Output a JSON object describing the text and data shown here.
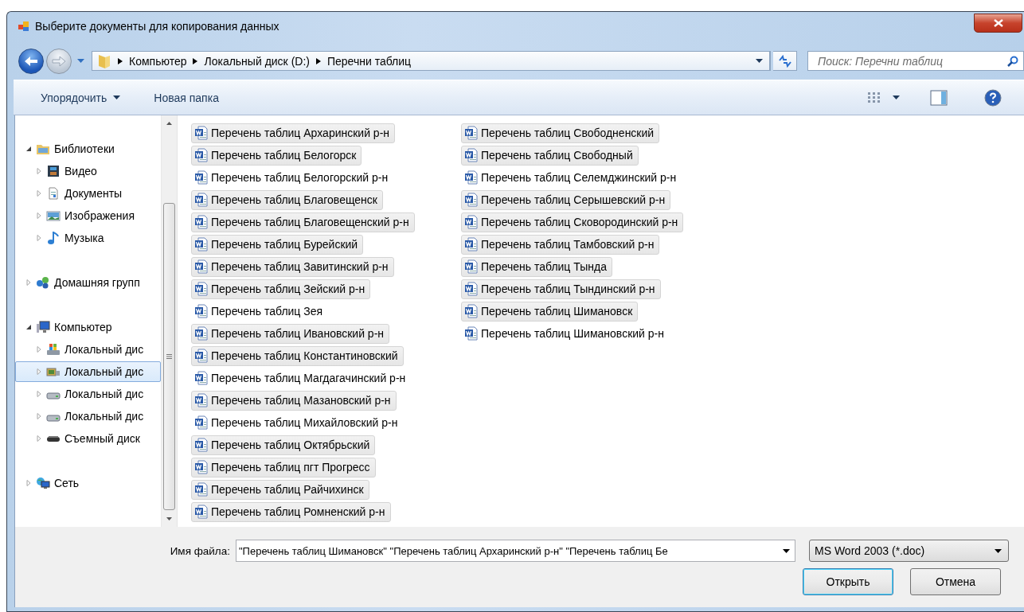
{
  "window": {
    "title": "Выберите документы для копирования данных"
  },
  "navigation": {
    "breadcrumb": [
      "Компьютер",
      "Локальный диск (D:)",
      "Перечни таблиц"
    ],
    "search": {
      "placeholder": "Поиск: Перечни таблиц"
    }
  },
  "toolbar": {
    "items": [
      {
        "label": "Упорядочить",
        "dropdown": true
      },
      {
        "label": "Новая папка",
        "dropdown": false
      }
    ]
  },
  "tree": [
    {
      "label": "Библиотеки",
      "kind": "library",
      "expanded": true,
      "selected": false,
      "children": [
        {
          "label": "Видео",
          "kind": "video",
          "expanded": false,
          "selected": false
        },
        {
          "label": "Документы",
          "kind": "documents",
          "expanded": false,
          "selected": false
        },
        {
          "label": "Изображения",
          "kind": "pictures",
          "expanded": false,
          "selected": false
        },
        {
          "label": "Музыка",
          "kind": "music",
          "expanded": false,
          "selected": false
        }
      ]
    },
    {
      "label": "Домашняя групп",
      "kind": "homegroup",
      "expanded": false,
      "selected": false
    },
    {
      "label": "Компьютер",
      "kind": "computer",
      "expanded": true,
      "selected": false,
      "children": [
        {
          "label": "Локальный дис",
          "kind": "system-drive",
          "expanded": false,
          "selected": false
        },
        {
          "label": "Локальный дис",
          "kind": "media-drive",
          "expanded": false,
          "selected": true
        },
        {
          "label": "Локальный дис",
          "kind": "drive",
          "expanded": false,
          "selected": false
        },
        {
          "label": "Локальный дис",
          "kind": "drive",
          "expanded": false,
          "selected": false
        },
        {
          "label": "Съемный диск",
          "kind": "removable",
          "expanded": false,
          "selected": false
        }
      ]
    },
    {
      "label": "Сеть",
      "kind": "network",
      "expanded": false,
      "selected": false
    }
  ],
  "files": [
    {
      "name": "Перечень таблиц Архаринский р-н",
      "selected": true
    },
    {
      "name": "Перечень таблиц Белогорск",
      "selected": true
    },
    {
      "name": "Перечень таблиц Белогорский р-н",
      "selected": false
    },
    {
      "name": "Перечень таблиц Благовещенск",
      "selected": true
    },
    {
      "name": "Перечень таблиц Благовещенский р-н",
      "selected": true
    },
    {
      "name": "Перечень таблиц Бурейский",
      "selected": true
    },
    {
      "name": "Перечень таблиц Завитинский р-н",
      "selected": true
    },
    {
      "name": "Перечень таблиц Зейский р-н",
      "selected": true
    },
    {
      "name": "Перечень таблиц Зея",
      "selected": false
    },
    {
      "name": "Перечень таблиц Ивановский р-н",
      "selected": true
    },
    {
      "name": "Перечень таблиц Константиновский",
      "selected": true
    },
    {
      "name": "Перечень таблиц Магдагачинский р-н",
      "selected": false
    },
    {
      "name": "Перечень таблиц Мазановский р-н",
      "selected": true
    },
    {
      "name": "Перечень таблиц Михайловский р-н",
      "selected": false
    },
    {
      "name": "Перечень таблиц Октябрьский",
      "selected": true
    },
    {
      "name": "Перечень таблиц пгт Прогресс",
      "selected": true
    },
    {
      "name": "Перечень таблиц Райчихинск",
      "selected": true
    },
    {
      "name": "Перечень таблиц Ромненский р-н",
      "selected": true
    },
    {
      "name": "Перечень таблиц Свободненский",
      "selected": true
    },
    {
      "name": "Перечень таблиц Свободный",
      "selected": true
    },
    {
      "name": "Перечень таблиц Селемджинский р-н",
      "selected": false
    },
    {
      "name": "Перечень таблиц Серышевский р-н",
      "selected": true
    },
    {
      "name": "Перечень таблиц Сковородинский р-н",
      "selected": true
    },
    {
      "name": "Перечень таблиц Тамбовский р-н",
      "selected": true
    },
    {
      "name": "Перечень таблиц Тында",
      "selected": true
    },
    {
      "name": "Перечень таблиц Тындинский р-н",
      "selected": true
    },
    {
      "name": "Перечень таблиц Шимановск",
      "selected": true
    },
    {
      "name": "Перечень таблиц Шимановский р-н",
      "selected": false
    }
  ],
  "footer": {
    "filename_label": "Имя файла:",
    "filename_value": "\"Перечень таблиц Шимановск\" \"Перечень таблиц Архаринский р-н\" \"Перечень таблиц Бе",
    "file_type": "MS Word 2003 (*.doc)",
    "buttons": [
      {
        "label": "Открыть",
        "default": true
      },
      {
        "label": "Отмена",
        "default": false
      }
    ]
  }
}
